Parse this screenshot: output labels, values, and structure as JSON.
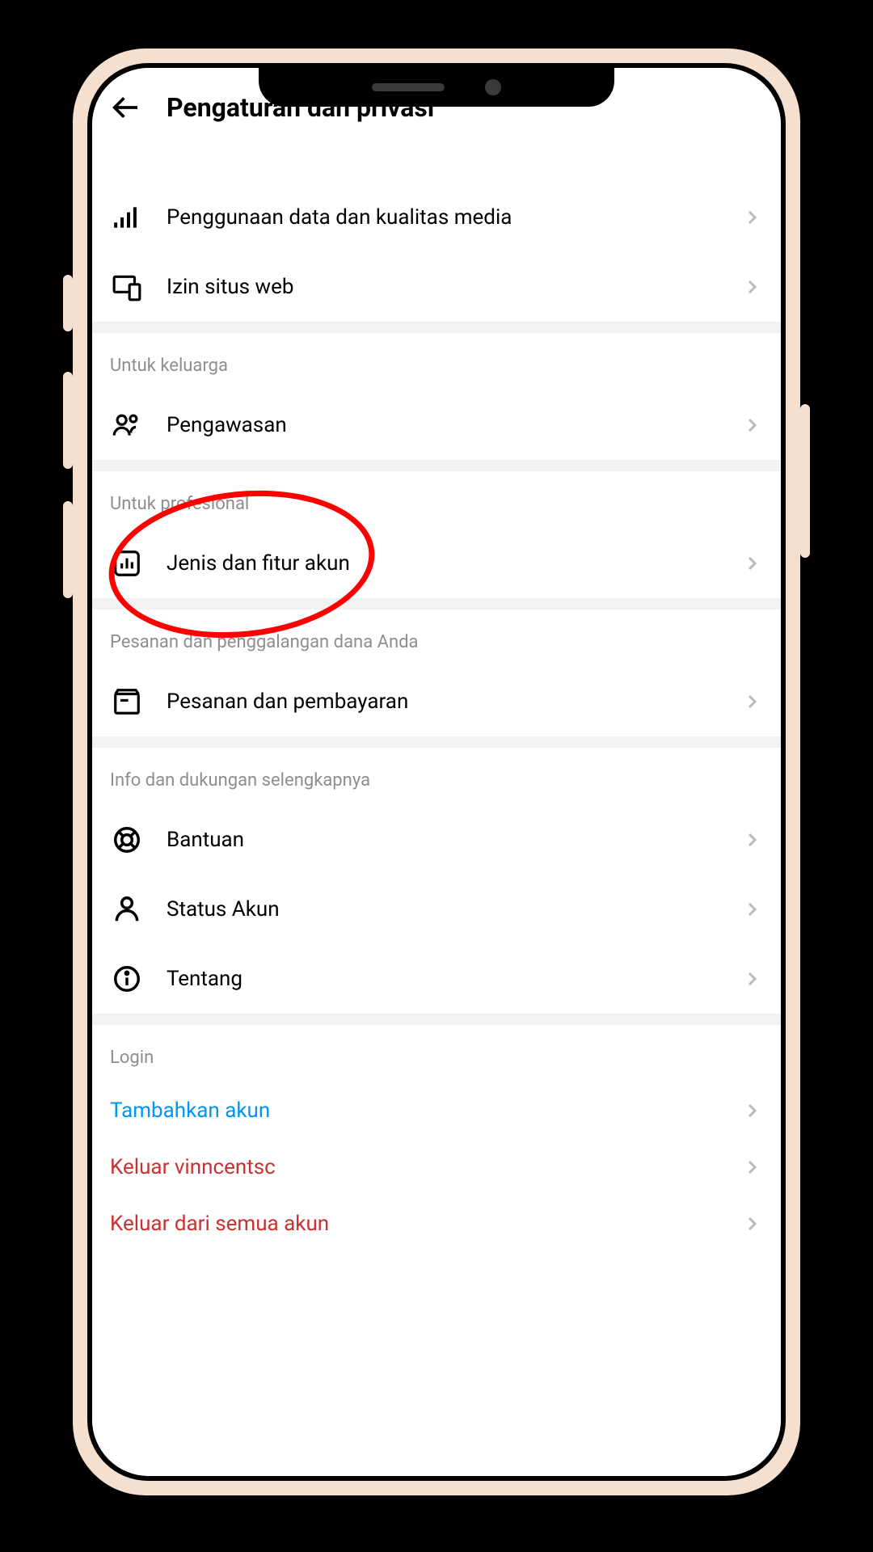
{
  "header": {
    "title": "Pengaturan dan privasi"
  },
  "sections": {
    "misc": {
      "items": [
        {
          "label": "Penggunaan data dan kualitas media",
          "icon": "signal-icon"
        },
        {
          "label": "Izin situs web",
          "icon": "devices-icon"
        }
      ]
    },
    "family": {
      "title": "Untuk keluarga",
      "items": [
        {
          "label": "Pengawasan",
          "icon": "people-icon"
        }
      ]
    },
    "professional": {
      "title": "Untuk profesional",
      "items": [
        {
          "label": "Jenis dan fitur akun",
          "icon": "chart-icon"
        }
      ]
    },
    "orders": {
      "title": "Pesanan dan penggalangan dana Anda",
      "items": [
        {
          "label": "Pesanan dan pembayaran",
          "icon": "package-icon"
        }
      ]
    },
    "info_support": {
      "title": "Info dan dukungan selengkapnya",
      "items": [
        {
          "label": "Bantuan",
          "icon": "help-icon"
        },
        {
          "label": "Status Akun",
          "icon": "person-icon"
        },
        {
          "label": "Tentang",
          "icon": "info-icon"
        }
      ]
    },
    "login": {
      "title": "Login",
      "items": [
        {
          "label": "Tambahkan akun",
          "style": "blue"
        },
        {
          "label": "Keluar vinncentsc",
          "style": "red"
        },
        {
          "label": "Keluar dari semua akun",
          "style": "red"
        }
      ]
    }
  }
}
